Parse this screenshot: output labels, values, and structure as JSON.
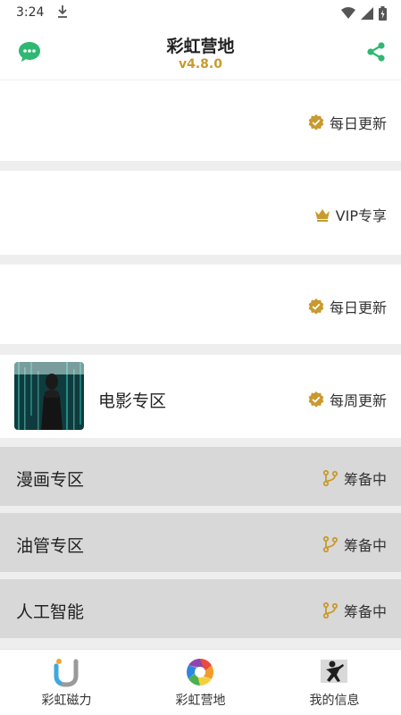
{
  "status_bar": {
    "time": "3:24"
  },
  "header": {
    "title": "彩虹营地",
    "version": "v4.8.0"
  },
  "cards": [
    {
      "tag": "每日更新",
      "tag_icon": "verified-icon"
    },
    {
      "tag": "VIP专享",
      "tag_icon": "crown-icon"
    },
    {
      "tag": "每日更新",
      "tag_icon": "verified-icon"
    },
    {
      "title": "电影专区",
      "tag": "每周更新",
      "tag_icon": "verified-icon"
    }
  ],
  "sections": [
    {
      "label": "漫画专区",
      "status": "筹备中",
      "status_icon": "branch-icon"
    },
    {
      "label": "油管专区",
      "status": "筹备中",
      "status_icon": "branch-icon"
    },
    {
      "label": "人工智能",
      "status": "筹备中",
      "status_icon": "branch-icon"
    }
  ],
  "bottom_nav": [
    {
      "label": "彩虹磁力",
      "icon": "magnet-u-icon"
    },
    {
      "label": "彩虹营地",
      "icon": "rainbow-aperture-icon"
    },
    {
      "label": "我的信息",
      "icon": "profile-figure-icon"
    }
  ],
  "colors": {
    "accent_gold": "#c99a2e",
    "green": "#2eb872",
    "gap_grey": "#eeeeee",
    "section_grey": "#d8d8d8"
  }
}
